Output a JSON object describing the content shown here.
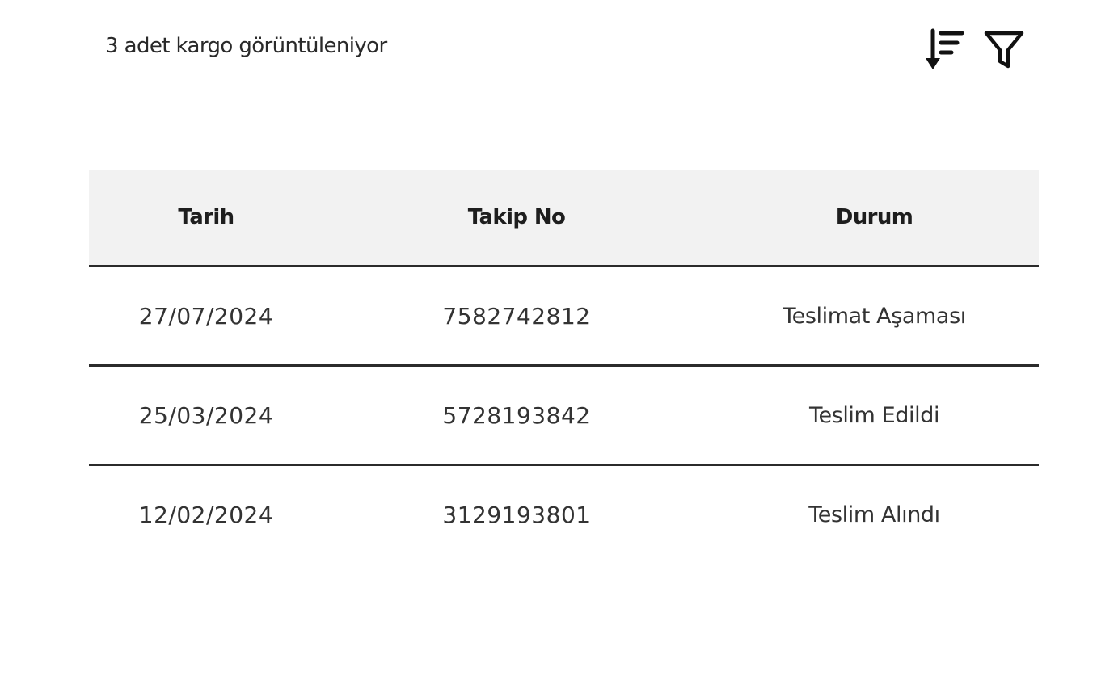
{
  "summary": {
    "count_text": "3 adet kargo görüntüleniyor"
  },
  "toolbar": {
    "sort_icon": "sort-descending-icon",
    "filter_icon": "filter-icon",
    "icon_color": "#111111"
  },
  "table": {
    "headers": {
      "date": "Tarih",
      "tracking": "Takip No",
      "status": "Durum"
    },
    "rows": [
      {
        "date": "27/07/2024",
        "tracking": "7582742812",
        "status": "Teslimat Aşaması"
      },
      {
        "date": "25/03/2024",
        "tracking": "5728193842",
        "status": "Teslim Edildi"
      },
      {
        "date": "12/02/2024",
        "tracking": "3129193801",
        "status": "Teslim Alındı"
      }
    ],
    "header_background": "#f2f2f2",
    "divider_color": "#2b2b2b"
  }
}
